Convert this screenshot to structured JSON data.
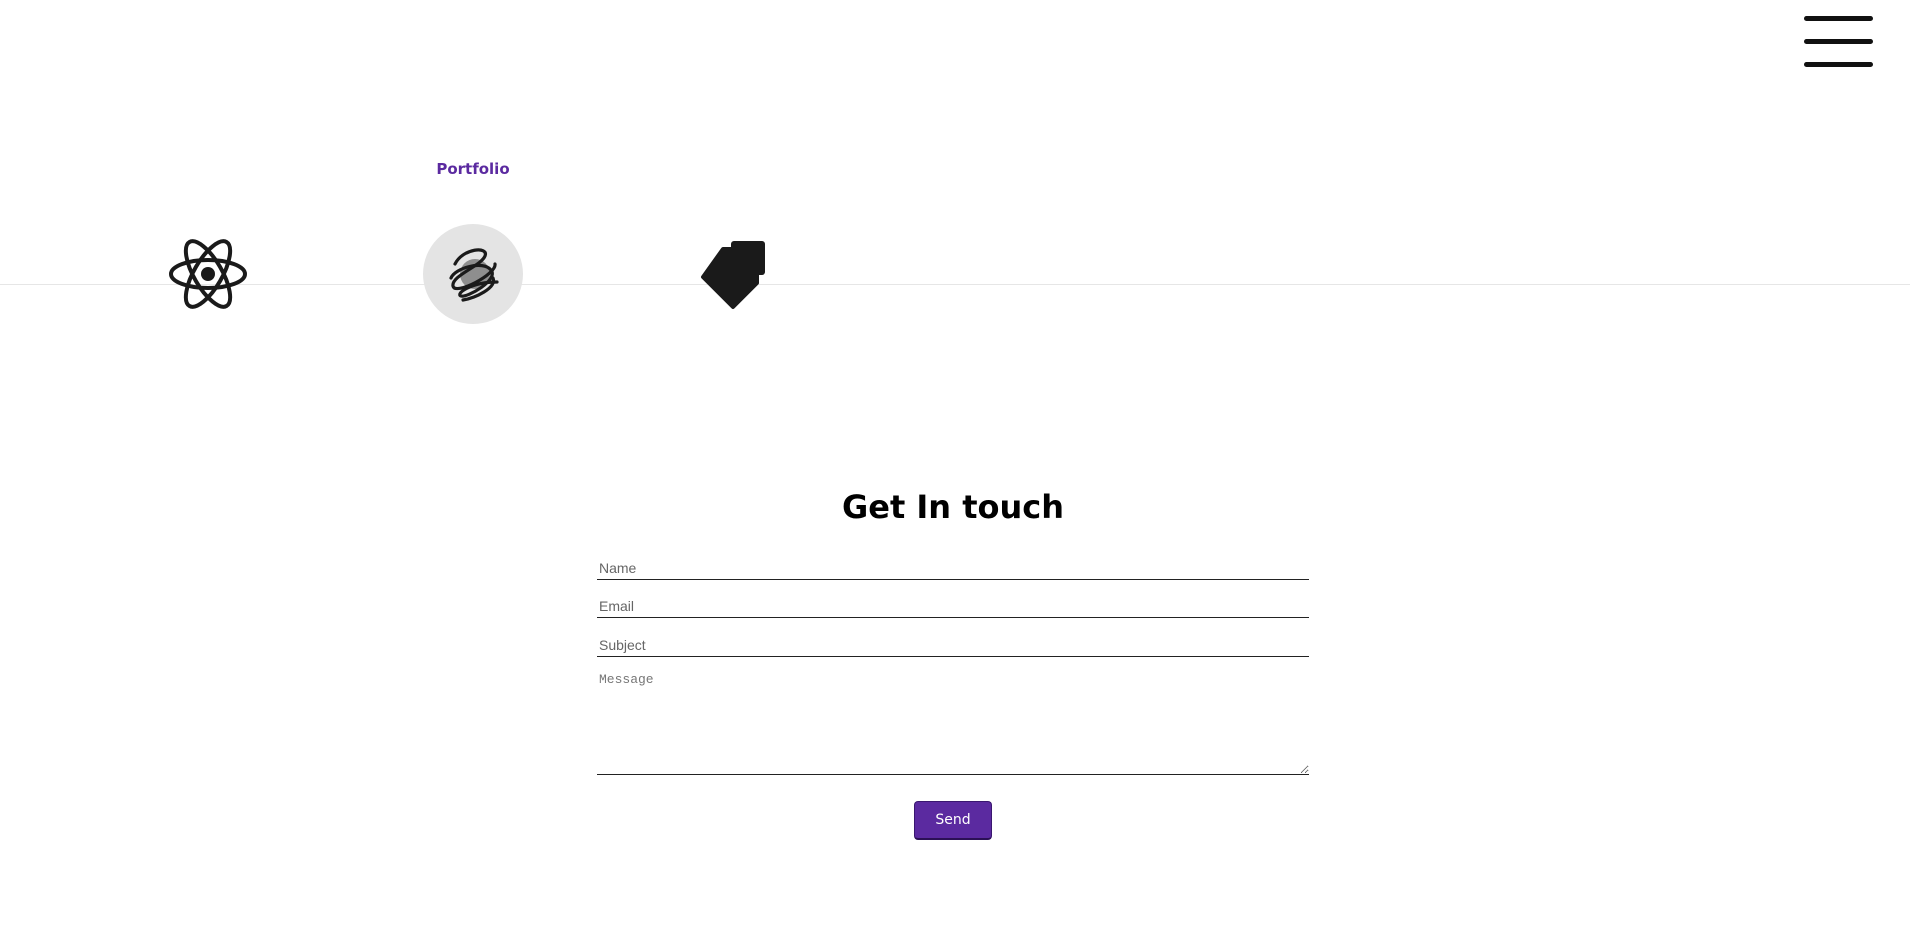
{
  "header": {
    "menu_icon": "hamburger-menu-icon"
  },
  "tech_strip": {
    "active_label": "Portfolio",
    "items": [
      {
        "icon": "react-atom-icon",
        "active": false
      },
      {
        "icon": "scribble-icon",
        "active": true
      },
      {
        "icon": "stacked-diamond-icon",
        "active": false
      }
    ]
  },
  "contact": {
    "title": "Get In touch",
    "name_placeholder": "Name",
    "email_placeholder": "Email",
    "subject_placeholder": "Subject",
    "message_placeholder": "Message",
    "send_label": "Send"
  },
  "colors": {
    "accent": "#5b2aa0",
    "active_circle": "#e4e4e4",
    "text": "#111111"
  }
}
